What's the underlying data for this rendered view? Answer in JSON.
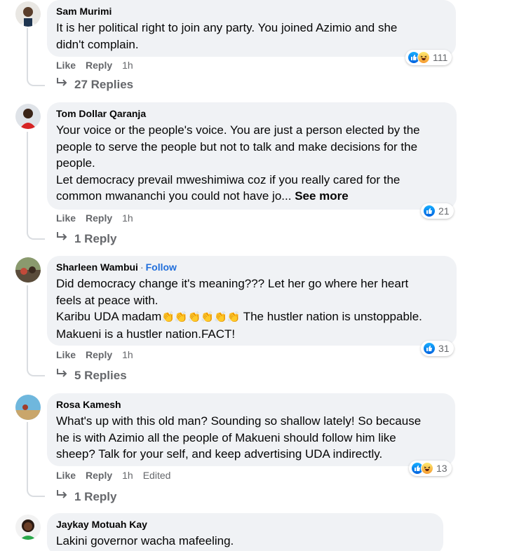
{
  "colors": {
    "bubble": "#f0f2f5",
    "meta": "#65676b",
    "link": "#216fdb",
    "like": "#0062df",
    "haha": "#f69b30"
  },
  "comments": [
    {
      "author": "Sam Murimi",
      "lines": [
        "It is her political right to join any party. You joined Azimio and she",
        "didn't complain."
      ],
      "reactions": [
        "like-icon",
        "haha-icon"
      ],
      "reaction_count": "111",
      "actions": {
        "like": "Like",
        "reply": "Reply",
        "time": "1h"
      },
      "replies_label": "27 Replies"
    },
    {
      "author": "Tom Dollar Qaranja",
      "lines": [
        "Your voice or the people's voice. You are just a person elected by the",
        "people to serve the people but not to talk and make decisions for the",
        "people.",
        "Let democracy prevail mweshimiwa coz if you really cared for the",
        "common mwananchi you could not have jo..."
      ],
      "see_more": "See more",
      "reactions": [
        "like-icon"
      ],
      "reaction_count": "21",
      "actions": {
        "like": "Like",
        "reply": "Reply",
        "time": "1h"
      },
      "replies_label": "1 Reply"
    },
    {
      "author": "Sharleen Wambui",
      "author_sep": "·",
      "follow": "Follow",
      "lines": [
        "Did democracy change it's meaning??? Let her go where her heart",
        "feels at peace with."
      ],
      "line3_prefix": "Karibu UDA madam",
      "claps": "👏👏👏👏👏👏",
      "line3_suffix": " The hustler nation is unstoppable.",
      "line4": "Makueni is a hustler nation.FACT!",
      "reactions": [
        "like-icon"
      ],
      "reaction_count": "31",
      "actions": {
        "like": "Like",
        "reply": "Reply",
        "time": "1h"
      },
      "replies_label": "5 Replies"
    },
    {
      "author": "Rosa Kamesh",
      "lines": [
        "What's up with this old man? Sounding so shallow lately! So because",
        "he is with Azimio all the people of Makueni should follow him like",
        "sheep? Talk for your self, and keep advertising UDA indirectly."
      ],
      "reactions": [
        "like-icon",
        "haha-icon"
      ],
      "reaction_count": "13",
      "actions": {
        "like": "Like",
        "reply": "Reply",
        "time": "1h",
        "edited": "Edited"
      },
      "replies_label": "1 Reply"
    },
    {
      "author": "Jaykay Motuah Kay",
      "lines": [
        "Lakini governor wacha mafeeling."
      ]
    }
  ]
}
